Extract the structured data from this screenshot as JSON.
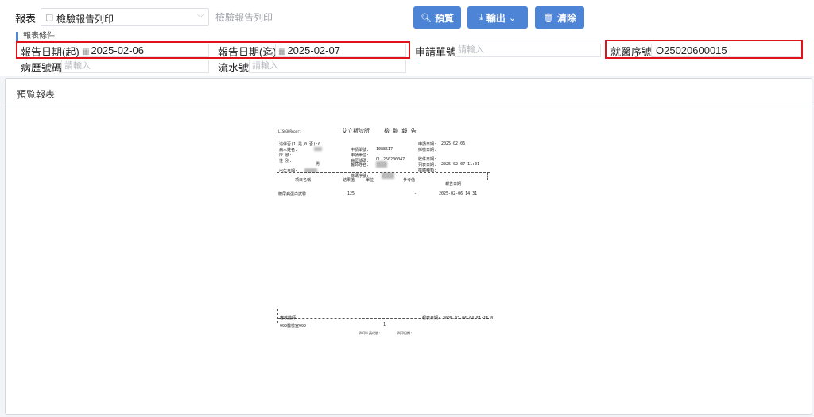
{
  "toolbar": {
    "report_label": "報表",
    "report_select_value": "檢驗報告列印",
    "report_name": "檢驗報告列印",
    "preview_label": "預覧",
    "export_label": "輸出",
    "clear_label": "清除"
  },
  "conditions": {
    "section_title": "報表條件",
    "date_start_label": "報告日期(起)",
    "date_start_value": "2025-02-06",
    "date_end_label": "報告日期(迄)",
    "date_end_value": "2025-02-07",
    "request_no_label": "申請單號",
    "request_no_placeholder": "請輸入",
    "visit_no_label": "就醫序號",
    "visit_no_value": "O25020600015",
    "chart_no_label": "病歷號碼",
    "chart_no_placeholder": "請輸入",
    "serial_no_label": "流水號",
    "serial_no_placeholder": "請輸入"
  },
  "preview": {
    "title": "預覧報表",
    "doc": {
      "report_id": "LIS030Report_",
      "clinic_title": "艾立斯診所",
      "doc_title": "檢 驗 報 告",
      "urgent": "追伴否(1:是,0:否):0",
      "patient_name": "病人姓名:",
      "bed": "床    號:",
      "gender": "性    別:",
      "gender_value": "男",
      "birth": "出生日期:",
      "request_no_label": "申請單號:",
      "request_no_value": "1088517",
      "order_unit": "申請單位:",
      "chart_no": "病歷號碼:",
      "chart_no_value": "OL-250200047",
      "doctor": "醫師姓名:",
      "request_date_label": "申請日期:",
      "request_date_value": "2025-02-06",
      "collect_date": "採檢日期:",
      "receive_date": "收件日期:",
      "print_date_label": "列表日期:",
      "print_date_value": "2025-02-07 11:01",
      "specimen_type": "檢體種類:",
      "barcode": "條碼序號:",
      "col_item": "項目名稱",
      "col_result": "結果值",
      "col_unit": "單位",
      "col_ref": "參考值",
      "col_report_date": "報告日期",
      "row_item": "糖尿病蛋白試驗",
      "row_result": "125",
      "row_ref": "-",
      "row_report_date": "2025-02-06 14:31",
      "footer_verifier": "審核醫師:",
      "footer_print_time": "報表日期: 2025-02-06 04:51:15.0",
      "footer_name": "999醫檢室999",
      "footer_page": "1",
      "footer_printer": "列印人員代號:",
      "footer_sign": "列印日期:"
    }
  }
}
